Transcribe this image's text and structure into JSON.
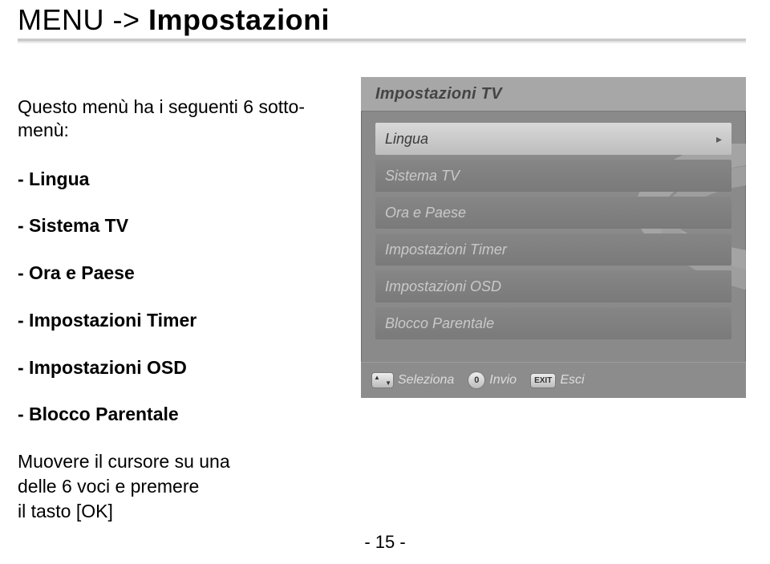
{
  "breadcrumb": {
    "menu": "MENU",
    "arrow": "->",
    "current": "Impostazioni"
  },
  "intro": "Questo menù ha i seguenti 6 sotto-menù:",
  "items": {
    "lingua": "- Lingua",
    "sistema": "- Sistema TV",
    "ora": "- Ora e Paese",
    "timer": "- Impostazioni Timer",
    "osd": "- Impostazioni OSD",
    "blocco": "- Blocco Parentale"
  },
  "instruction": {
    "l1": "Muovere il cursore su una",
    "l2": "delle 6 voci e premere",
    "l3": "il tasto [OK]"
  },
  "osd": {
    "header": "Impostazioni TV",
    "rows": {
      "lingua": "Lingua",
      "sistema": "Sistema TV",
      "ora": "Ora e Paese",
      "timer": "Impostazioni Timer",
      "osd": "Impostazioni OSD",
      "blocco": "Blocco Parentale"
    },
    "footer": {
      "seleziona": "Seleziona",
      "invio": "Invio",
      "esci": "Esci",
      "ok_key": "0",
      "exit_key": "EXIT"
    }
  },
  "page_number": "- 15 -"
}
